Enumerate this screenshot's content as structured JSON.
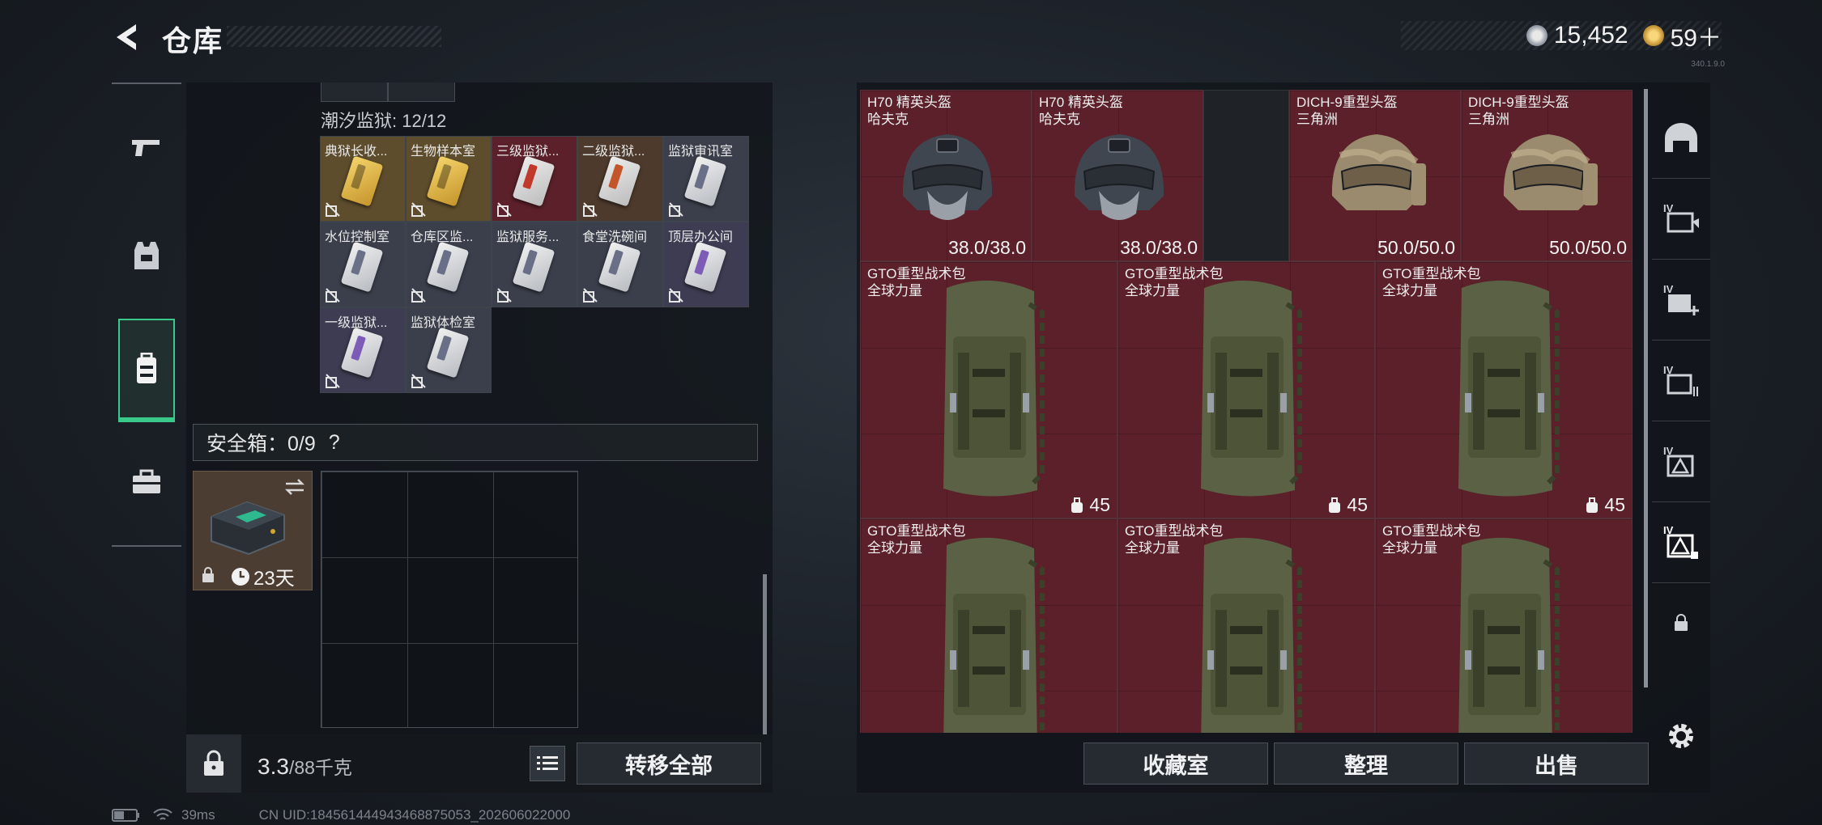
{
  "header": {
    "title": "仓库"
  },
  "currency": {
    "coins": "15,452",
    "tickets": "59＋"
  },
  "version": "340.1.9.0",
  "left_categories": [
    {
      "name": "weapons",
      "icon": "pistol-icon"
    },
    {
      "name": "armor",
      "icon": "vest-icon"
    },
    {
      "name": "backpack",
      "icon": "backpack-icon",
      "active": true
    },
    {
      "name": "case",
      "icon": "toolbox-icon"
    }
  ],
  "keys_section": {
    "label": "潮汐监狱: 12/12",
    "keys": [
      {
        "name": "典狱长收...",
        "color": "gold"
      },
      {
        "name": "生物样本室",
        "color": "gold"
      },
      {
        "name": "三级监狱...",
        "color": "red"
      },
      {
        "name": "二级监狱...",
        "color": "orange"
      },
      {
        "name": "监狱审讯室",
        "color": "white"
      },
      {
        "name": "水位控制室",
        "color": "white"
      },
      {
        "name": "仓库区监...",
        "color": "white"
      },
      {
        "name": "监狱服务...",
        "color": "white"
      },
      {
        "name": "食堂洗碗间",
        "color": "white"
      },
      {
        "name": "顶层办公间",
        "color": "purple"
      },
      {
        "name": "一级监狱...",
        "color": "purple"
      },
      {
        "name": "监狱体检室",
        "color": "white"
      }
    ]
  },
  "safe_box": {
    "label": "安全箱：0/9",
    "help": "?",
    "timer": "23天"
  },
  "bottom": {
    "weight_value": "3.3",
    "weight_max": "/88千克",
    "transfer_all": "转移全部"
  },
  "items": [
    {
      "name": "H70 精英头盔",
      "sub": "哈夫克",
      "value": "38.0/38.0",
      "type": "helmet-black"
    },
    {
      "name": "H70 精英头盔",
      "sub": "哈夫克",
      "value": "38.0/38.0",
      "type": "helmet-black"
    },
    {
      "name": "DICH-9重型头盔",
      "sub": "三角洲",
      "value": "50.0/50.0",
      "type": "helmet-camo"
    },
    {
      "name": "DICH-9重型头盔",
      "sub": "三角洲",
      "value": "50.0/50.0",
      "type": "helmet-camo"
    },
    {
      "name": "GTO重型战术包",
      "sub": "全球力量",
      "value": "45",
      "type": "backpack"
    },
    {
      "name": "GTO重型战术包",
      "sub": "全球力量",
      "value": "45",
      "type": "backpack"
    },
    {
      "name": "GTO重型战术包",
      "sub": "全球力量",
      "value": "45",
      "type": "backpack"
    },
    {
      "name": "GTO重型战术包",
      "sub": "全球力量",
      "value": "",
      "type": "backpack"
    },
    {
      "name": "GTO重型战术包",
      "sub": "全球力量",
      "value": "",
      "type": "backpack"
    },
    {
      "name": "GTO重型战术包",
      "sub": "全球力量",
      "value": "",
      "type": "backpack"
    }
  ],
  "actions": {
    "collection": "收藏室",
    "organize": "整理",
    "sell": "出售"
  },
  "right_categories": [
    "helmet-tab-icon",
    "storage-iv-1-icon",
    "storage-iv-add-icon",
    "storage-iv-list-icon",
    "storage-iv-warn-icon",
    "storage-iv-active-icon",
    "lock-icon"
  ],
  "status_bar": {
    "ping": "39ms",
    "uid": "CN UID:1845614449434688750​53_202606022000"
  }
}
